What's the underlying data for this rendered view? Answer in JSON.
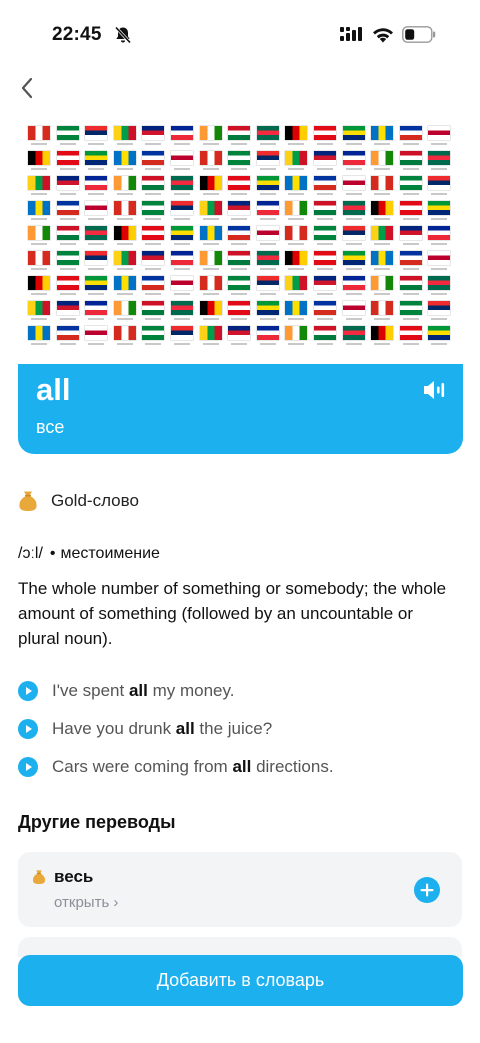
{
  "status_bar": {
    "time": "22:45"
  },
  "word": {
    "title": "all",
    "translation": "все"
  },
  "badge": {
    "label": "Gold-слово"
  },
  "pronunciation": "/ɔːl/",
  "separator": "•",
  "part_of_speech": "местоимение",
  "definition": "The whole number of something or somebody; the whole amount of something (followed by an uncountable or plural noun).",
  "examples": [
    {
      "before": "I've spent ",
      "bold": "all",
      "after": " my money."
    },
    {
      "before": "Have you drunk ",
      "bold": "all",
      "after": " the juice?"
    },
    {
      "before": "Cars were coming from ",
      "bold": "all",
      "after": " directions."
    }
  ],
  "other_translations": {
    "title": "Другие переводы",
    "items": [
      {
        "word": "весь",
        "open_label": "открыть ›"
      }
    ]
  },
  "add_button_label": "Добавить в словарь",
  "colors": {
    "accent": "#1cb0ee",
    "gold": "#e8a93a",
    "card_bg": "#f3f4f6"
  },
  "icons": [
    "bell-slash-icon",
    "signal-icon",
    "wifi-icon",
    "battery-icon",
    "back-chevron-icon",
    "speaker-icon",
    "gold-bag-icon",
    "play-icon",
    "plus-circle-icon"
  ]
}
